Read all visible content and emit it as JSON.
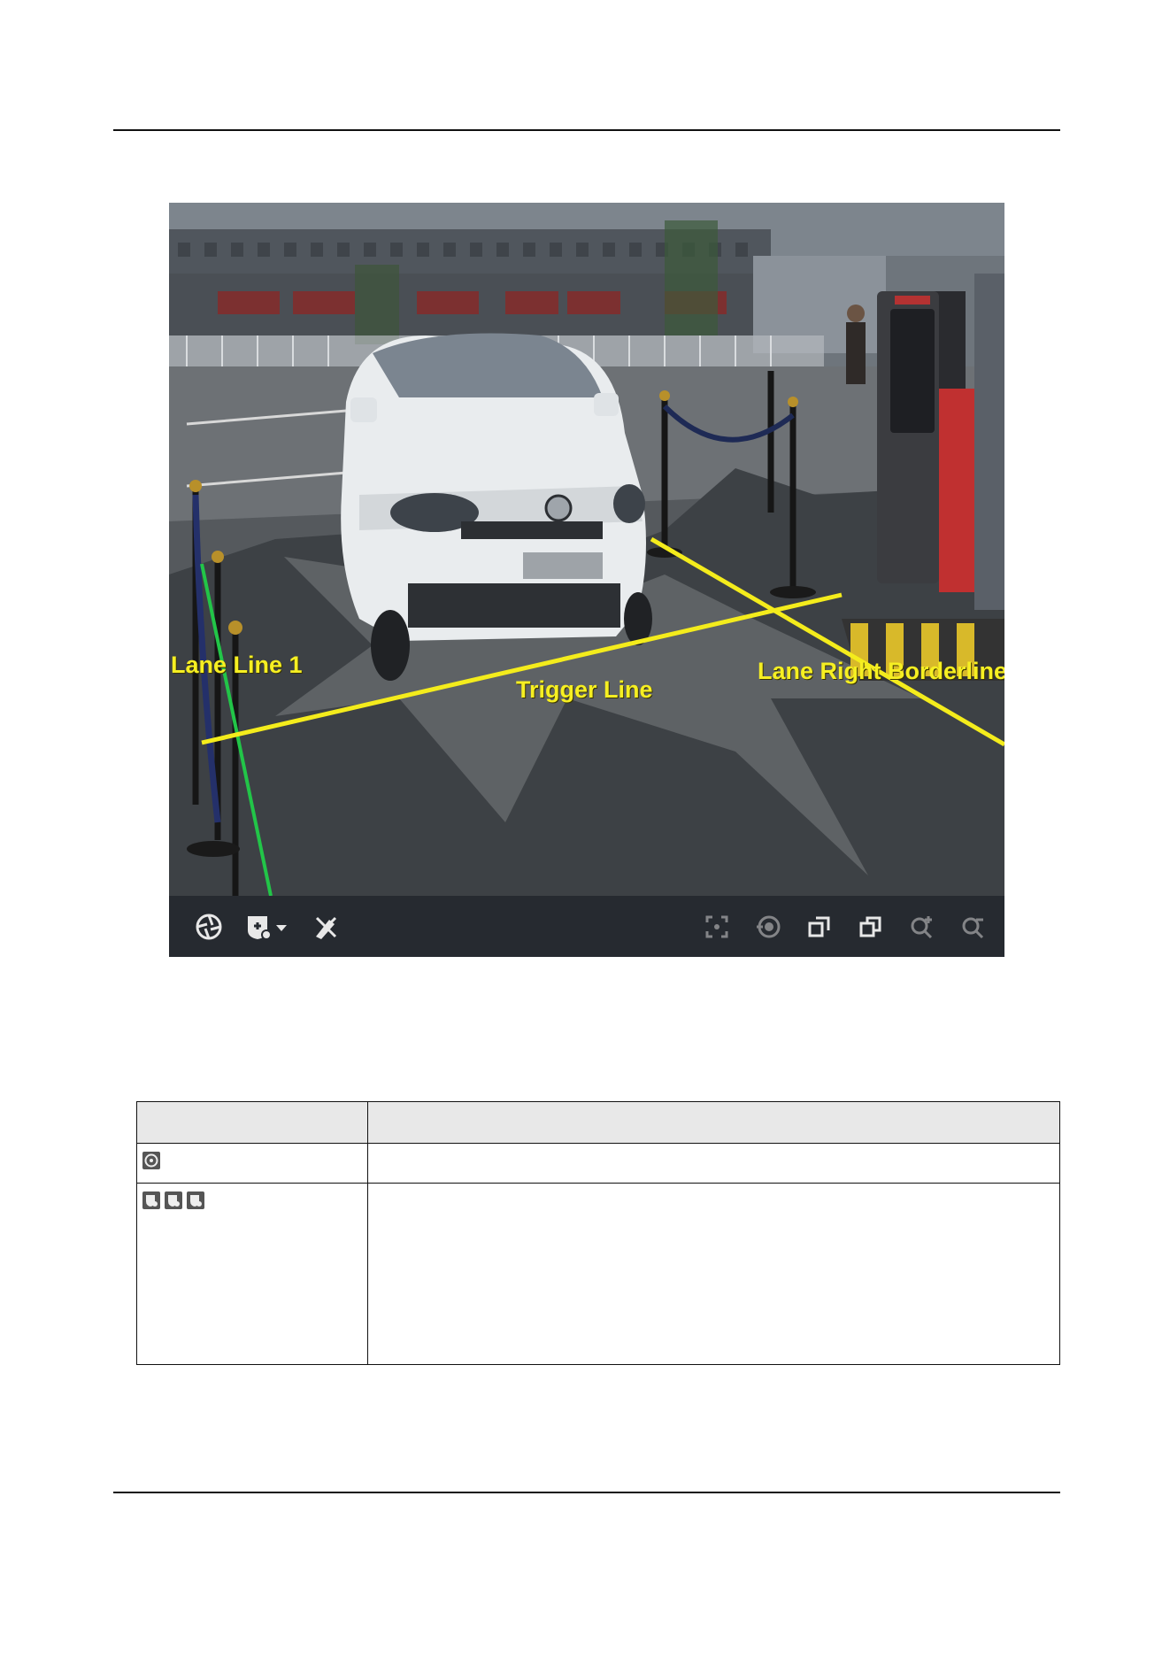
{
  "figure": {
    "labels": {
      "lane_line": "Lane Line 1",
      "trigger_line": "Trigger Line",
      "lane_right_borderline": "Lane Right Borderline"
    },
    "colors": {
      "trigger_and_border_lines": "#f4ec1c",
      "lane_line": "#22c548",
      "toolbar_bg": "#262a30"
    },
    "toolbar": {
      "left_icons": [
        "aperture-icon",
        "draw-area-dropdown-icon",
        "clear-draw-icon"
      ],
      "right_icons": [
        "capture-frame-icon",
        "record-icon",
        "restore-icon",
        "window-icon",
        "zoom-in-icon",
        "zoom-out-icon"
      ]
    }
  },
  "table": {
    "headers": [
      "",
      ""
    ],
    "rows": [
      {
        "icons": [
          "aperture-icon"
        ],
        "description": ""
      },
      {
        "icons": [
          "lane-icon-1",
          "lane-icon-2",
          "lane-icon-3"
        ],
        "description": ""
      }
    ]
  }
}
